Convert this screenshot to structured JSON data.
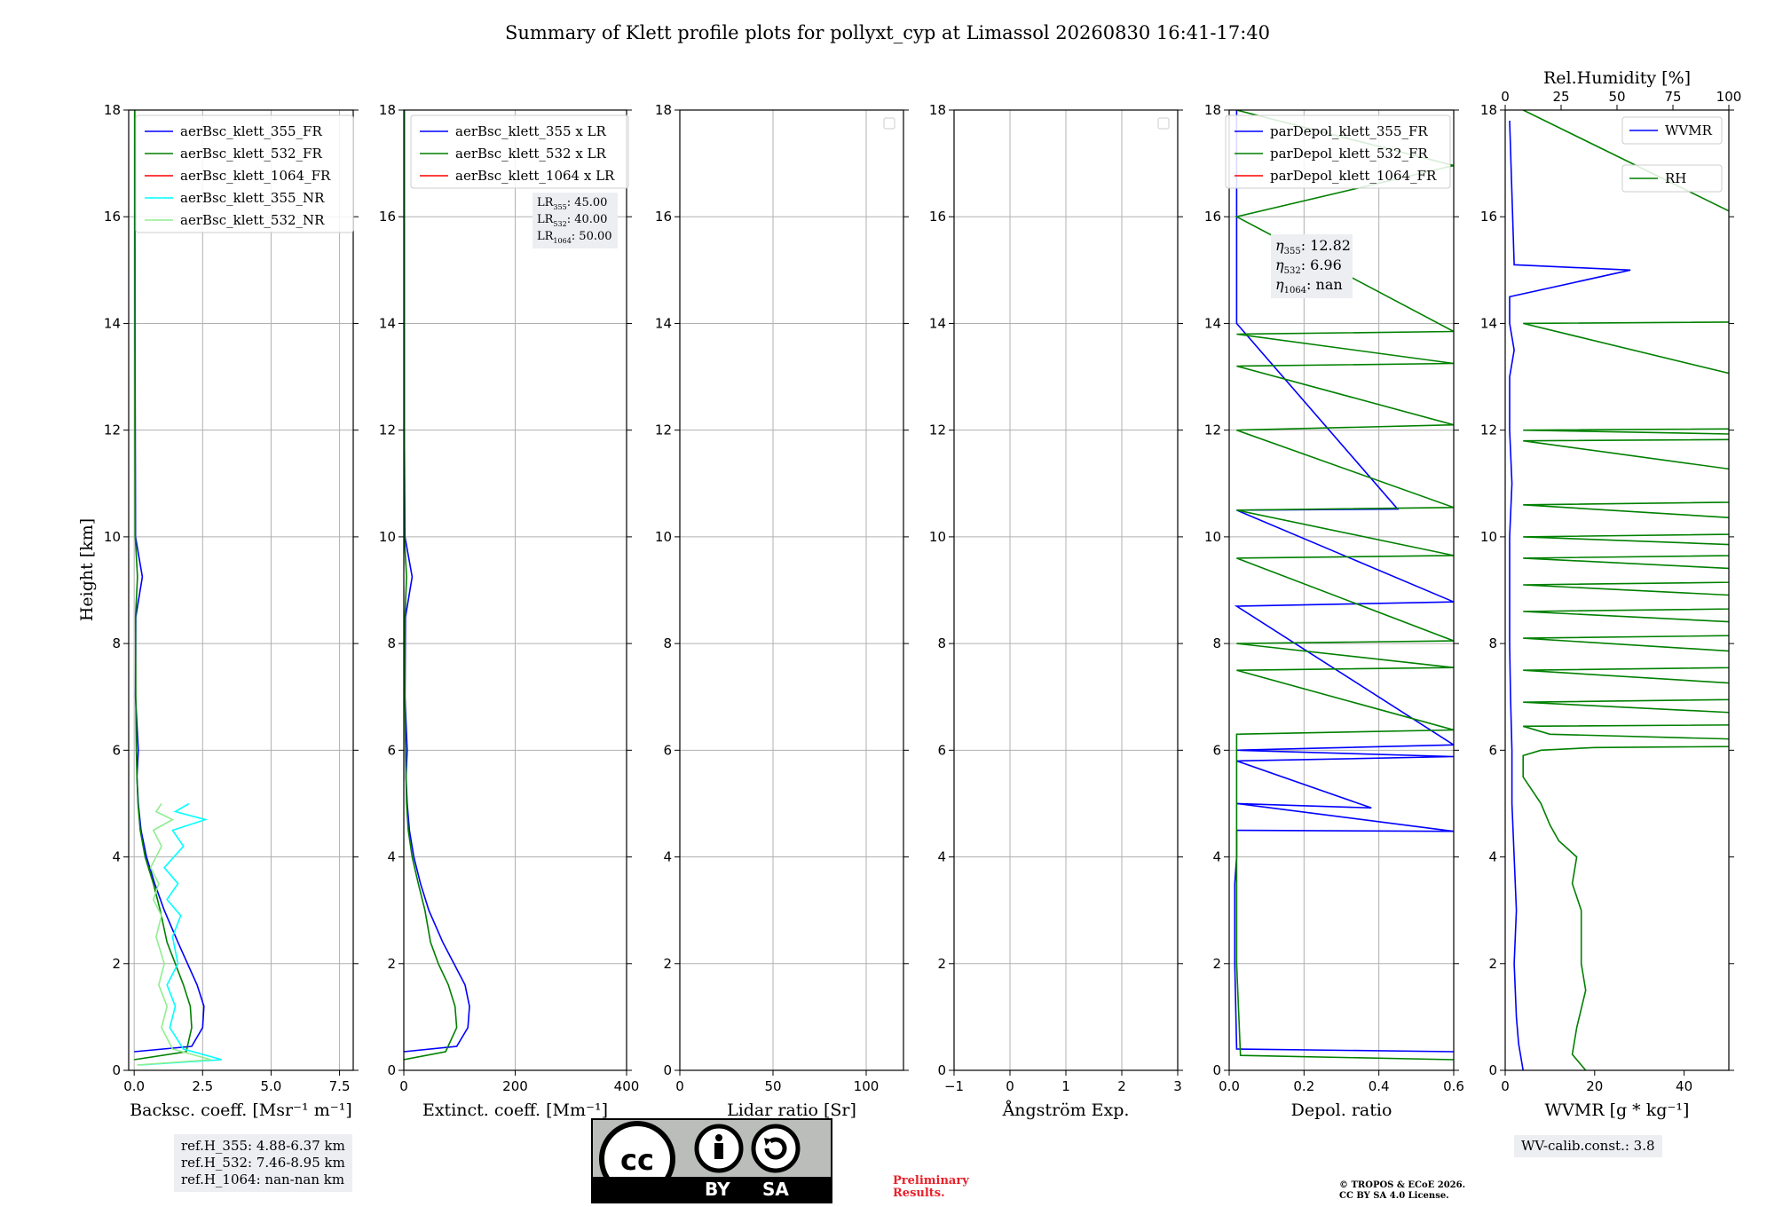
{
  "figure": {
    "title": "Summary of Klett profile plots for pollyxt_cyp at Limassol 20260830 16:41-17:40",
    "ylabel": "Height [km]",
    "ref_heights": [
      "ref.H_355: 4.88-6.37 km",
      "ref.H_532: 7.46-8.95 km",
      "ref.H_1064: nan-nan km"
    ],
    "wv_calib": "WV-calib.const.: 3.8",
    "preliminary": [
      "Preliminary",
      "Results."
    ],
    "copyright": [
      "© TROPOS & ECoE 2026.",
      "CC BY SA 4.0 License."
    ],
    "license_badge": {
      "cc": "cc",
      "by": "BY",
      "sa": "SA"
    },
    "colors": {
      "blue": "#0000ff",
      "green": "#008000",
      "red": "#ff0000",
      "cyan": "#00ffff",
      "lightgreen": "#90ee90",
      "grid": "#b0b0b0"
    }
  },
  "chart_data": [
    {
      "type": "line",
      "xlabel": "Backsc. coeff. [Msr⁻¹ m⁻¹]",
      "ylabel": "Height [km]",
      "xlim": [
        -0.2,
        8
      ],
      "ylim": [
        0,
        18
      ],
      "xticks": [
        0,
        2.5,
        5,
        7.5
      ],
      "xtick_labels": [
        "0.0",
        "2.5",
        "5.0",
        "7.5"
      ],
      "yticks": [
        0,
        2,
        4,
        6,
        8,
        10,
        12,
        14,
        16,
        18
      ],
      "grid": true,
      "legend": "upper-left",
      "legend_entries": [
        "aerBsc_klett_355_FR",
        "aerBsc_klett_532_FR",
        "aerBsc_klett_1064_FR",
        "aerBsc_klett_355_NR",
        "aerBsc_klett_532_NR"
      ],
      "series": [
        {
          "name": "aerBsc_klett_355_FR",
          "color": "#0000ff",
          "x": [
            0,
            2.1,
            2.5,
            2.55,
            2.3,
            1.95,
            1.6,
            1.1,
            0.75,
            0.45,
            0.25,
            0.15,
            0.1,
            0.15,
            0.05,
            0.06,
            0.3,
            0.05,
            0.04,
            0.03,
            0.02
          ],
          "y": [
            0.35,
            0.45,
            0.8,
            1.2,
            1.6,
            2.0,
            2.4,
            3.0,
            3.5,
            4.0,
            4.5,
            5.0,
            5.5,
            6.0,
            7.0,
            8.5,
            9.25,
            10.0,
            12.0,
            14.0,
            18.0
          ]
        },
        {
          "name": "aerBsc_klett_532_FR",
          "color": "#008000",
          "x": [
            0,
            1.9,
            2.1,
            2.05,
            1.8,
            1.5,
            1.2,
            0.95,
            0.7,
            0.4,
            0.22,
            0.14,
            0.1,
            0.08,
            0.06,
            0.05,
            0.12,
            0.04,
            0.03,
            0.03,
            0.02
          ],
          "y": [
            0.2,
            0.35,
            0.8,
            1.2,
            1.6,
            2.0,
            2.4,
            3.0,
            3.5,
            4.0,
            4.5,
            5.0,
            5.5,
            6.0,
            7.0,
            8.5,
            9.25,
            10.0,
            12.0,
            14.0,
            18.0
          ]
        },
        {
          "name": "aerBsc_klett_355_NR",
          "color": "#00ffff",
          "x": [
            0.2,
            3.2,
            1.8,
            1.3,
            1.5,
            1.2,
            1.6,
            1.4,
            1.7,
            1.2,
            1.6,
            1.1,
            1.8,
            1.4,
            2.6,
            1.5,
            2.0
          ],
          "y": [
            0.1,
            0.2,
            0.4,
            0.8,
            1.2,
            1.6,
            2.0,
            2.5,
            2.9,
            3.2,
            3.5,
            3.8,
            4.2,
            4.5,
            4.7,
            4.85,
            5.0
          ]
        },
        {
          "name": "aerBsc_klett_532_NR",
          "color": "#90ee90",
          "x": [
            0.1,
            2.8,
            1.4,
            1.0,
            1.2,
            0.9,
            1.1,
            0.8,
            1.0,
            0.7,
            0.9,
            0.6,
            1.0,
            0.7,
            1.4,
            0.8,
            1.0
          ],
          "y": [
            0.1,
            0.2,
            0.4,
            0.8,
            1.2,
            1.6,
            2.0,
            2.5,
            2.9,
            3.2,
            3.5,
            3.8,
            4.2,
            4.5,
            4.7,
            4.85,
            5.0
          ]
        }
      ]
    },
    {
      "type": "line",
      "xlabel": "Extinct. coeff. [Mm⁻¹]",
      "xlim": [
        0,
        400
      ],
      "ylim": [
        0,
        18
      ],
      "xticks": [
        0,
        200,
        400
      ],
      "xtick_labels": [
        "0",
        "200",
        "400"
      ],
      "yticks": [
        0,
        2,
        4,
        6,
        8,
        10,
        12,
        14,
        16,
        18
      ],
      "grid": true,
      "legend": "upper-left",
      "legend_entries": [
        "aerBsc_klett_355 x LR",
        "aerBsc_klett_532 x LR",
        "aerBsc_klett_1064 x LR"
      ],
      "annotation_lines": [
        {
          "base": "LR",
          "sub": "355",
          "value": ": 45.00"
        },
        {
          "base": "LR",
          "sub": "532",
          "value": ": 40.00"
        },
        {
          "base": "LR",
          "sub": "1064",
          "value": ": 50.00"
        }
      ],
      "series": [
        {
          "name": "aerBsc_klett_355 x LR",
          "color": "#0000ff",
          "x": [
            0,
            95,
            115,
            118,
            110,
            90,
            70,
            45,
            30,
            18,
            10,
            6,
            4,
            6,
            2,
            3,
            15,
            2,
            1,
            1,
            1
          ],
          "y": [
            0.35,
            0.45,
            0.8,
            1.2,
            1.6,
            2.0,
            2.4,
            3.0,
            3.5,
            4.0,
            4.5,
            5.0,
            5.5,
            6.0,
            7.0,
            8.5,
            9.25,
            10.0,
            12.0,
            14.0,
            18.0
          ]
        },
        {
          "name": "aerBsc_klett_532 x LR",
          "color": "#008000",
          "x": [
            0,
            75,
            95,
            92,
            80,
            62,
            48,
            38,
            26,
            15,
            8,
            5,
            4,
            3,
            2,
            2,
            5,
            1,
            1,
            1,
            1
          ],
          "y": [
            0.2,
            0.35,
            0.8,
            1.2,
            1.6,
            2.0,
            2.4,
            3.0,
            3.5,
            4.0,
            4.5,
            5.0,
            5.5,
            6.0,
            7.0,
            8.5,
            9.25,
            10.0,
            12.0,
            14.0,
            18.0
          ]
        }
      ]
    },
    {
      "type": "line",
      "xlabel": "Lidar ratio [Sr]",
      "xlim": [
        0,
        120
      ],
      "ylim": [
        0,
        18
      ],
      "xticks": [
        0,
        50,
        100
      ],
      "xtick_labels": [
        "0",
        "50",
        "100"
      ],
      "yticks": [
        0,
        2,
        4,
        6,
        8,
        10,
        12,
        14,
        16,
        18
      ],
      "grid": true,
      "legend": "upper-right",
      "legend_entries": [],
      "series": []
    },
    {
      "type": "line",
      "xlabel": "Ångström Exp.",
      "xlim": [
        -1,
        3
      ],
      "ylim": [
        0,
        18
      ],
      "xticks": [
        -1,
        0,
        1,
        2,
        3
      ],
      "xtick_labels": [
        "−1",
        "0",
        "1",
        "2",
        "3"
      ],
      "yticks": [
        0,
        2,
        4,
        6,
        8,
        10,
        12,
        14,
        16,
        18
      ],
      "grid": true,
      "legend": "upper-right",
      "legend_entries": [],
      "series": []
    },
    {
      "type": "line",
      "xlabel": "Depol. ratio",
      "xlim": [
        0,
        0.6
      ],
      "ylim": [
        0,
        18
      ],
      "xticks": [
        0,
        0.2,
        0.4,
        0.6
      ],
      "xtick_labels": [
        "0.0",
        "0.2",
        "0.4",
        "0.6"
      ],
      "yticks": [
        0,
        2,
        4,
        6,
        8,
        10,
        12,
        14,
        16,
        18
      ],
      "grid": true,
      "legend": "upper-left",
      "legend_entries": [
        "parDepol_klett_355_FR",
        "parDepol_klett_532_FR",
        "parDepol_klett_1064_FR"
      ],
      "annotation_lines": [
        {
          "base": "η",
          "sub": "355",
          "value": ": 12.82"
        },
        {
          "base": "η",
          "sub": "532",
          "value": ": 6.96"
        },
        {
          "base": "η",
          "sub": "1064",
          "value": ": nan"
        }
      ],
      "series": [
        {
          "name": "parDepol_klett_355_FR",
          "color": "#0000ff",
          "x": [
            0.6,
            0.02,
            0.015,
            0.015,
            0.02,
            0.02,
            0.02,
            0.6,
            0.02,
            0.38,
            0.02,
            0.6,
            0.02,
            0.6,
            0.02,
            0.6,
            0.02,
            0.45,
            0.02,
            0.02
          ],
          "y": [
            0.35,
            0.4,
            2.0,
            3.5,
            4.0,
            4.05,
            4.5,
            4.48,
            5.0,
            4.92,
            5.8,
            5.88,
            6.0,
            6.1,
            8.7,
            8.78,
            10.5,
            10.52,
            14.0,
            18.0
          ]
        },
        {
          "name": "parDepol_klett_532_FR",
          "color": "#008000",
          "x": [
            0.6,
            0.03,
            0.02,
            0.02,
            0.02,
            0.6,
            0.02,
            0.6,
            0.02,
            0.6,
            0.02,
            0.6,
            0.02,
            0.6,
            0.02,
            0.6,
            0.02,
            0.6,
            0.02,
            0.6,
            0.02,
            0.6,
            0.02
          ],
          "y": [
            0.2,
            0.28,
            2.0,
            4.0,
            6.3,
            6.38,
            7.5,
            7.55,
            8.0,
            8.05,
            9.6,
            9.65,
            10.5,
            10.55,
            12.0,
            12.1,
            13.2,
            13.25,
            13.8,
            13.85,
            16.0,
            16.96,
            18.0
          ]
        }
      ]
    },
    {
      "type": "line",
      "xlabel": "WVMR [g * kg⁻¹]",
      "xlim": [
        0,
        50
      ],
      "ylim": [
        0,
        18
      ],
      "xticks": [
        0,
        20,
        40
      ],
      "xtick_labels": [
        "0",
        "20",
        "40"
      ],
      "yticks": [
        0,
        2,
        4,
        6,
        8,
        10,
        12,
        14,
        16,
        18
      ],
      "secondary_x": {
        "label": "Rel.Humidity [%]",
        "lim": [
          0,
          100
        ],
        "ticks": [
          0,
          25,
          50,
          75,
          100
        ],
        "tick_labels": [
          "0",
          "25",
          "50",
          "75",
          "100"
        ]
      },
      "grid": false,
      "legend": "upper-right",
      "legend_entries": [
        "WVMR",
        "RH"
      ],
      "series": [
        {
          "name": "WVMR",
          "color": "#0000ff",
          "x": [
            4,
            3,
            2.5,
            2,
            2.5,
            2,
            1.5,
            1.5,
            1.2,
            1,
            1,
            1,
            1.5,
            1,
            1,
            2,
            1,
            1,
            28,
            2,
            1
          ],
          "y": [
            0,
            0.5,
            1.0,
            2.0,
            3.0,
            4.0,
            5.0,
            6.0,
            7.0,
            8.0,
            9.0,
            10.0,
            11.0,
            12.0,
            13.0,
            13.5,
            14.0,
            14.5,
            15.0,
            15.1,
            17.8
          ]
        },
        {
          "name": "RH",
          "color": "#008000",
          "x": [
            18,
            15,
            16,
            18,
            17,
            17,
            15,
            16,
            12,
            10,
            8,
            4,
            4,
            8,
            20,
            100,
            10,
            4,
            100,
            4,
            100,
            4,
            100,
            4,
            100,
            4,
            100,
            4,
            100,
            4,
            100,
            4,
            100,
            4,
            100,
            4,
            100,
            4,
            100,
            4,
            100,
            4
          ],
          "y": [
            0,
            0.3,
            0.8,
            1.5,
            2.0,
            3.0,
            3.5,
            4.0,
            4.3,
            4.6,
            5.0,
            5.5,
            5.9,
            6.0,
            6.05,
            6.1,
            6.3,
            6.45,
            6.5,
            6.9,
            7.0,
            7.5,
            7.6,
            8.1,
            8.2,
            8.6,
            8.7,
            9.1,
            9.2,
            9.6,
            9.7,
            10.0,
            10.1,
            10.6,
            10.7,
            11.8,
            11.85,
            12.0,
            12.05,
            14.0,
            14.05,
            18.0
          ]
        }
      ]
    }
  ]
}
